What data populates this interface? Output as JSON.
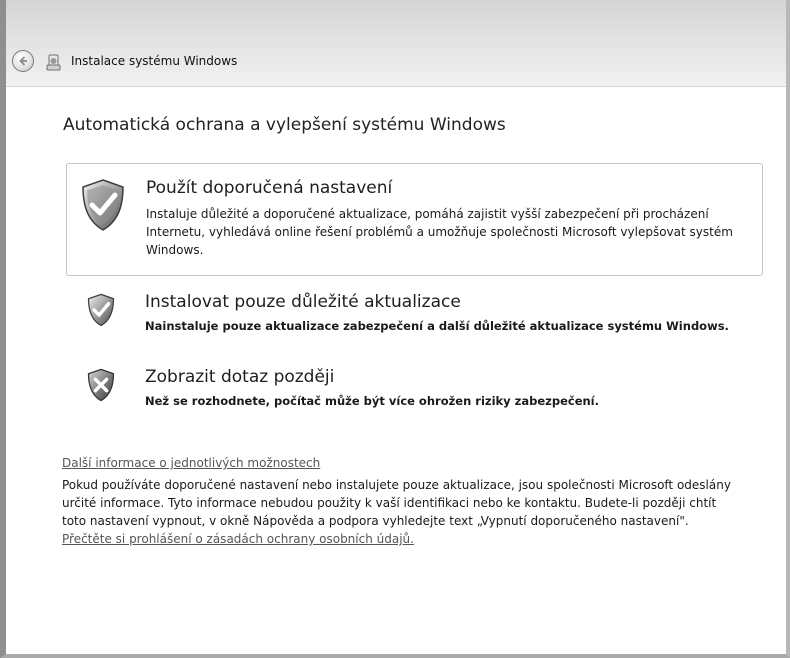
{
  "window": {
    "title": "Instalace systému Windows"
  },
  "main": {
    "heading": "Automatická ochrana a vylepšení systému Windows",
    "options": [
      {
        "title": "Použít doporučená nastavení",
        "description": "Instaluje důležité a doporučené aktualizace, pomáhá zajistit vyšší zabezpečení při procházení Internetu, vyhledává online řešení problémů a umožňuje společnosti Microsoft vylepšovat systém Windows.",
        "icon": "shield-check-icon"
      },
      {
        "title": "Instalovat pouze důležité aktualizace",
        "description": "Nainstaluje pouze aktualizace zabezpečení a další důležité aktualizace systému Windows.",
        "icon": "shield-check-icon"
      },
      {
        "title": "Zobrazit dotaz později",
        "description": "Než se rozhodnete, počítač může být více ohrožen riziky zabezpečení.",
        "icon": "shield-x-icon"
      }
    ],
    "more_info_link": "Další informace o jednotlivých možnostech",
    "info_text": "Pokud používáte doporučené nastavení nebo instalujete pouze aktualizace, jsou společnosti Microsoft odeslány určité informace. Tyto informace nebudou použity k vaší identifikaci nebo ke kontaktu. Budete-li později chtít toto nastavení vypnout, v okně Nápověda a podpora vyhledejte text „Vypnutí doporučeného nastavení\". ",
    "privacy_link": "Přečtěte si prohlášení o zásadách ochrany osobních údajů."
  },
  "colors": {
    "titlebar": "#e2e2e2",
    "link": "#555555",
    "border": "#c4c4c4"
  }
}
